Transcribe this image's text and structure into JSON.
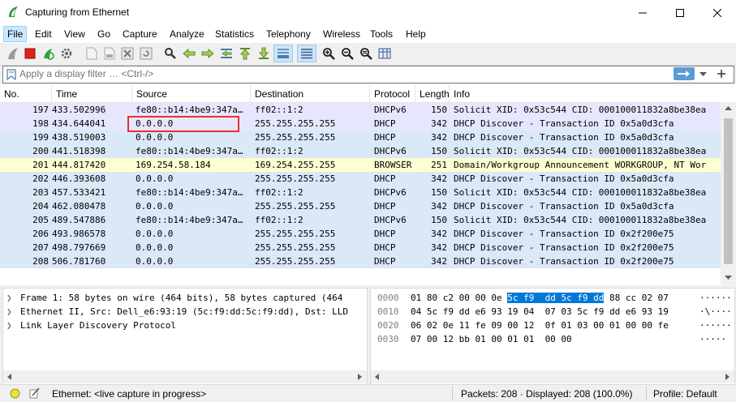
{
  "window": {
    "title": "Capturing from Ethernet"
  },
  "menu": [
    "File",
    "Edit",
    "View",
    "Go",
    "Capture",
    "Analyze",
    "Statistics",
    "Telephony",
    "Wireless",
    "Tools",
    "Help"
  ],
  "filter": {
    "placeholder": "Apply a display filter … <Ctrl-/>"
  },
  "columns": [
    "No.",
    "Time",
    "Source",
    "Destination",
    "Protocol",
    "Length",
    "Info"
  ],
  "packets": [
    {
      "no": "197",
      "time": "433.502996",
      "src": "fe80::b14:4be9:347a…",
      "dst": "ff02::1:2",
      "proto": "DHCPv6",
      "len": "150",
      "info": "Solicit XID: 0x53c544 CID: 000100011832a8be38ea",
      "bg": "#e7e6ff"
    },
    {
      "no": "198",
      "time": "434.644041",
      "src": "0.0.0.0",
      "dst": "255.255.255.255",
      "proto": "DHCP",
      "len": "342",
      "info": "DHCP Discover - Transaction ID 0x5a0d3cfa",
      "bg": "#e7e6ff"
    },
    {
      "no": "199",
      "time": "438.519003",
      "src": "0.0.0.0",
      "dst": "255.255.255.255",
      "proto": "DHCP",
      "len": "342",
      "info": "DHCP Discover - Transaction ID 0x5a0d3cfa",
      "bg": "#dae8f8"
    },
    {
      "no": "200",
      "time": "441.518398",
      "src": "fe80::b14:4be9:347a…",
      "dst": "ff02::1:2",
      "proto": "DHCPv6",
      "len": "150",
      "info": "Solicit XID: 0x53c544 CID: 000100011832a8be38ea",
      "bg": "#dae8f8"
    },
    {
      "no": "201",
      "time": "444.817420",
      "src": "169.254.58.184",
      "dst": "169.254.255.255",
      "proto": "BROWSER",
      "len": "251",
      "info": "Domain/Workgroup Announcement WORKGROUP, NT Wor",
      "bg": "#feffd0"
    },
    {
      "no": "202",
      "time": "446.393608",
      "src": "0.0.0.0",
      "dst": "255.255.255.255",
      "proto": "DHCP",
      "len": "342",
      "info": "DHCP Discover - Transaction ID 0x5a0d3cfa",
      "bg": "#dae8f8"
    },
    {
      "no": "203",
      "time": "457.533421",
      "src": "fe80::b14:4be9:347a…",
      "dst": "ff02::1:2",
      "proto": "DHCPv6",
      "len": "150",
      "info": "Solicit XID: 0x53c544 CID: 000100011832a8be38ea",
      "bg": "#dae8f8"
    },
    {
      "no": "204",
      "time": "462.080478",
      "src": "0.0.0.0",
      "dst": "255.255.255.255",
      "proto": "DHCP",
      "len": "342",
      "info": "DHCP Discover - Transaction ID 0x5a0d3cfa",
      "bg": "#dae8f8"
    },
    {
      "no": "205",
      "time": "489.547886",
      "src": "fe80::b14:4be9:347a…",
      "dst": "ff02::1:2",
      "proto": "DHCPv6",
      "len": "150",
      "info": "Solicit XID: 0x53c544 CID: 000100011832a8be38ea",
      "bg": "#dae8f8"
    },
    {
      "no": "206",
      "time": "493.986578",
      "src": "0.0.0.0",
      "dst": "255.255.255.255",
      "proto": "DHCP",
      "len": "342",
      "info": "DHCP Discover - Transaction ID 0x2f200e75",
      "bg": "#dae8f8"
    },
    {
      "no": "207",
      "time": "498.797669",
      "src": "0.0.0.0",
      "dst": "255.255.255.255",
      "proto": "DHCP",
      "len": "342",
      "info": "DHCP Discover - Transaction ID 0x2f200e75",
      "bg": "#dae8f8"
    },
    {
      "no": "208",
      "time": "506.781760",
      "src": "0.0.0.0",
      "dst": "255.255.255.255",
      "proto": "DHCP",
      "len": "342",
      "info": "DHCP Discover - Transaction ID 0x2f200e75",
      "bg": "#dae8f8"
    }
  ],
  "details": [
    "Frame 1: 58 bytes on wire (464 bits), 58 bytes captured (464",
    "Ethernet II, Src: Dell_e6:93:19 (5c:f9:dd:5c:f9:dd), Dst: LLD",
    "Link Layer Discovery Protocol"
  ],
  "hex": [
    {
      "offset": "0000",
      "pre": "01 80 c2 00 00 0e ",
      "sel": "5c f9  dd 5c f9 dd",
      "post": " 88 cc 02 07",
      "ascii": "······"
    },
    {
      "offset": "0010",
      "pre": "04 5c f9 dd e6 93 19 04  07 03 5c f9 dd e6 93 19",
      "sel": "",
      "post": "",
      "ascii": "·\\····"
    },
    {
      "offset": "0020",
      "pre": "06 02 0e 11 fe 09 00 12  0f 01 03 00 01 00 00 fe",
      "sel": "",
      "post": "",
      "ascii": "······"
    },
    {
      "offset": "0030",
      "pre": "07 00 12 bb 01 00 01 01  00 00",
      "sel": "",
      "post": "",
      "ascii": "·····"
    }
  ],
  "status": {
    "capture": "Ethernet: <live capture in progress>",
    "packets": "Packets: 208 · Displayed: 208 (100.0%)",
    "profile": "Profile: Default"
  },
  "colors": {
    "accent": "#0078d7",
    "highlight": "#e8312a",
    "hex_select": "#0078d7"
  }
}
